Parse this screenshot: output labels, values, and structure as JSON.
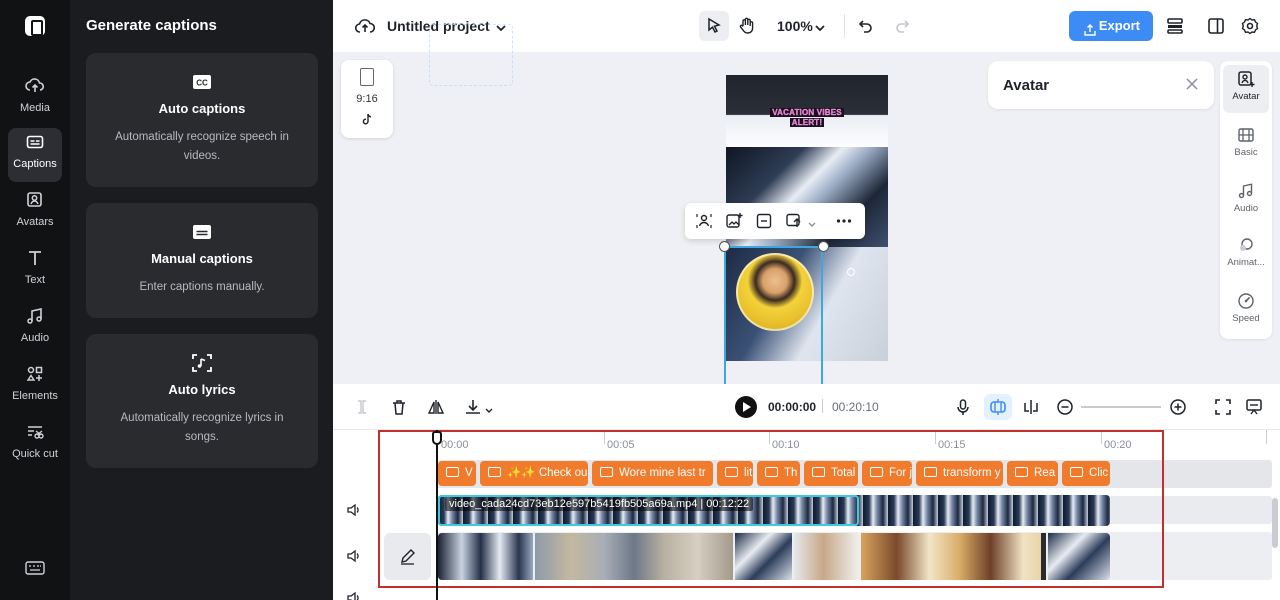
{
  "rail": {
    "items": [
      {
        "label": "Media",
        "icon": "cloud-upload-icon"
      },
      {
        "label": "Captions",
        "icon": "captions-icon"
      },
      {
        "label": "Avatars",
        "icon": "avatar-icon"
      },
      {
        "label": "Text",
        "icon": "text-icon"
      },
      {
        "label": "Audio",
        "icon": "music-note-icon"
      },
      {
        "label": "Elements",
        "icon": "elements-icon"
      },
      {
        "label": "Quick cut",
        "icon": "quick-cut-icon"
      }
    ],
    "active": "Captions"
  },
  "panel": {
    "title": "Generate captions",
    "cards": [
      {
        "title": "Auto captions",
        "desc": "Automatically recognize speech in videos.",
        "icon": "cc-icon"
      },
      {
        "title": "Manual captions",
        "desc": "Enter captions manually.",
        "icon": "subtitle-icon"
      },
      {
        "title": "Auto lyrics",
        "desc": "Automatically recognize lyrics in songs.",
        "icon": "lyrics-scan-icon"
      }
    ]
  },
  "topbar": {
    "project_name": "Untitled project",
    "zoom": "100%",
    "export_label": "Export"
  },
  "canvas": {
    "aspect_ratio": "9:16",
    "video_overlay_text_line1": "VACATION VIBES",
    "video_overlay_text_line2": "ALERT!"
  },
  "avatar_panel": {
    "title": "Avatar"
  },
  "right_rail": {
    "items": [
      {
        "label": "Avatar",
        "icon": "avatar-add-icon"
      },
      {
        "label": "Basic",
        "icon": "basic-film-icon"
      },
      {
        "label": "Audio",
        "icon": "music-note-icon"
      },
      {
        "label": "Animat...",
        "icon": "animation-icon"
      },
      {
        "label": "Speed",
        "icon": "speed-icon"
      }
    ],
    "active": "Avatar"
  },
  "timeline_toolbar": {
    "current_time": "00:00:00",
    "total_time": "00:20:10"
  },
  "timeline": {
    "ticks": [
      "00:00",
      "00:05",
      "00:10",
      "00:15",
      "00:20"
    ],
    "caption_chips": [
      "V",
      "✨✨ Check ou",
      "Wore mine last tr",
      "lit",
      "Th",
      "Total",
      "For j",
      "transform y",
      "Rea",
      "Clic"
    ],
    "video_label": "video_cada24cd73eb12e597b5419fb505a69a.mp4 | 00:12:22"
  }
}
